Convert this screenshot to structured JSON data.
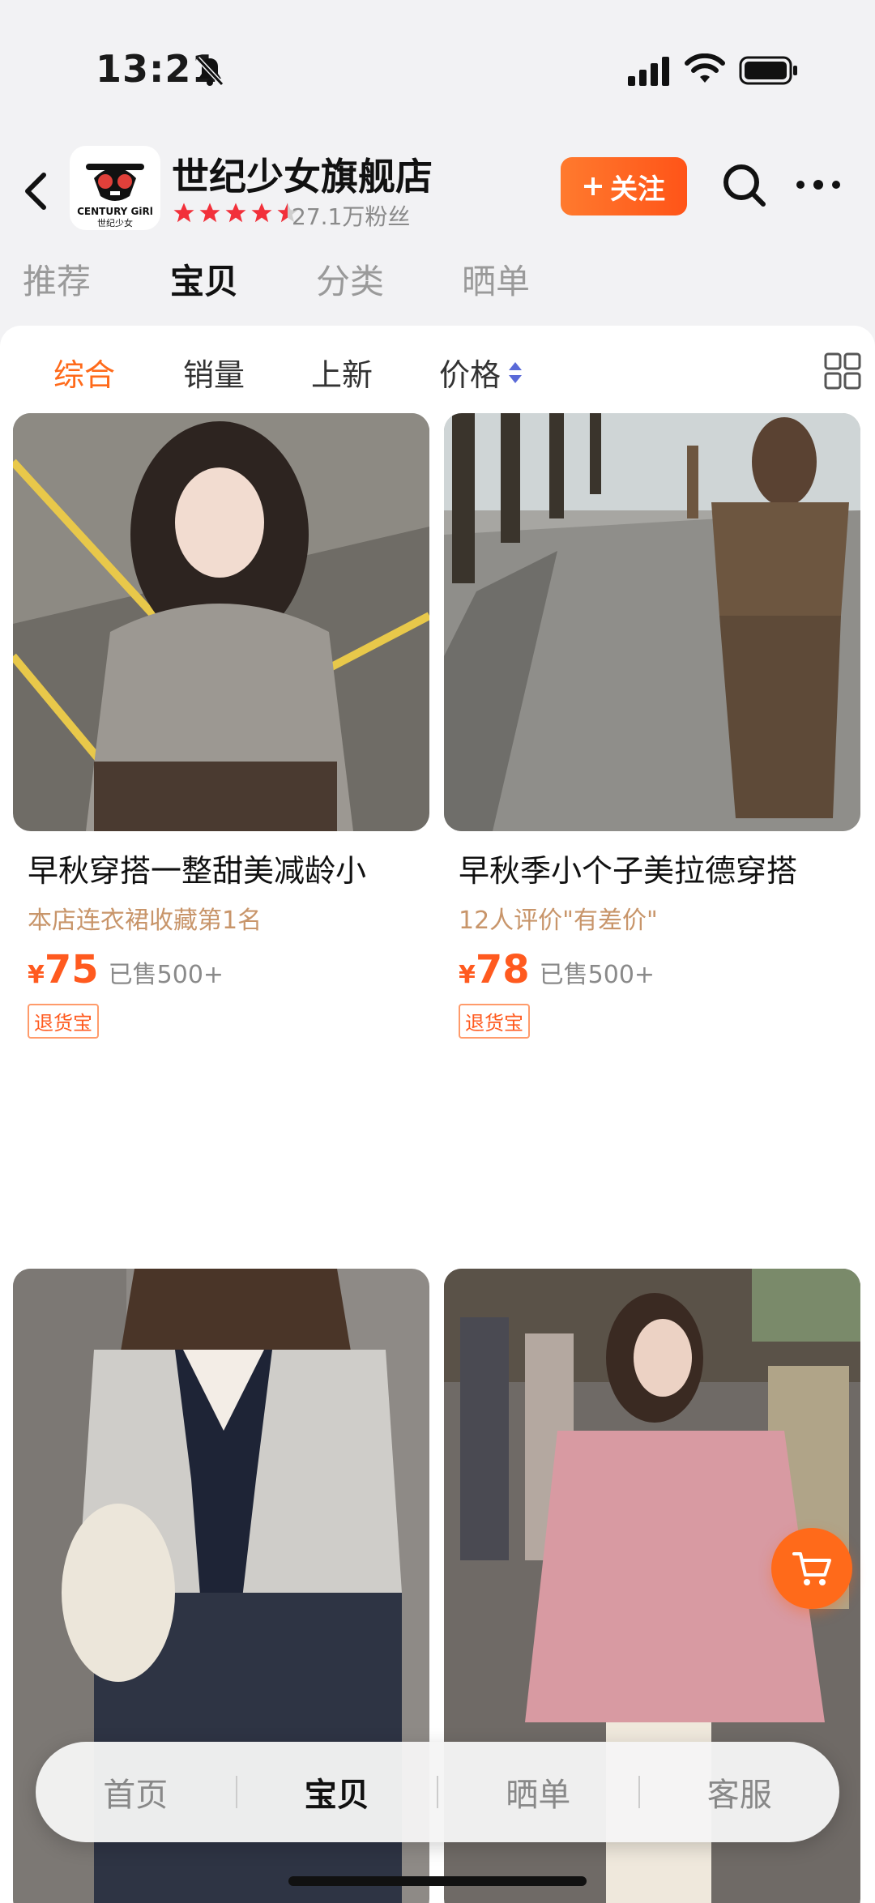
{
  "status_bar": {
    "time": "13:21",
    "icons": [
      "bell-off-icon",
      "signal-icon",
      "wifi-icon",
      "battery-icon"
    ]
  },
  "store": {
    "name": "世纪少女旗舰店",
    "logo_text": [
      "CENTURY GiRl",
      "世纪少女"
    ],
    "rating_stars": 4.5,
    "fans": "27.1万粉丝",
    "follow_label": "关注",
    "accent_color": "#ff5a1f"
  },
  "tabs": [
    {
      "label": "推荐",
      "active": false
    },
    {
      "label": "宝贝",
      "active": true
    },
    {
      "label": "分类",
      "active": false
    },
    {
      "label": "晒单",
      "active": false
    }
  ],
  "sort_bar": [
    {
      "label": "综合",
      "active": true
    },
    {
      "label": "销量",
      "active": false
    },
    {
      "label": "上新",
      "active": false
    },
    {
      "label": "价格",
      "active": false
    }
  ],
  "products": [
    {
      "title": "早秋穿搭一整甜美减龄小",
      "tag": "本店连衣裙收藏第1名",
      "currency": "¥",
      "price": "75",
      "sold": "已售500+",
      "badge": "退货宝"
    },
    {
      "title": "早秋季小个子美拉德穿搭",
      "tag": "12人评价\"有差价\"",
      "currency": "¥",
      "price": "78",
      "sold": "已售500+",
      "badge": "退货宝"
    },
    {
      "title": "",
      "tag": "",
      "currency": "",
      "price": "",
      "sold": "",
      "badge": ""
    },
    {
      "title": "",
      "tag": "",
      "currency": "",
      "price": "",
      "sold": "",
      "badge": ""
    }
  ],
  "bottom_nav": [
    {
      "label": "首页",
      "active": false
    },
    {
      "label": "宝贝",
      "active": true
    },
    {
      "label": "晒单",
      "active": false
    },
    {
      "label": "客服",
      "active": false
    }
  ]
}
